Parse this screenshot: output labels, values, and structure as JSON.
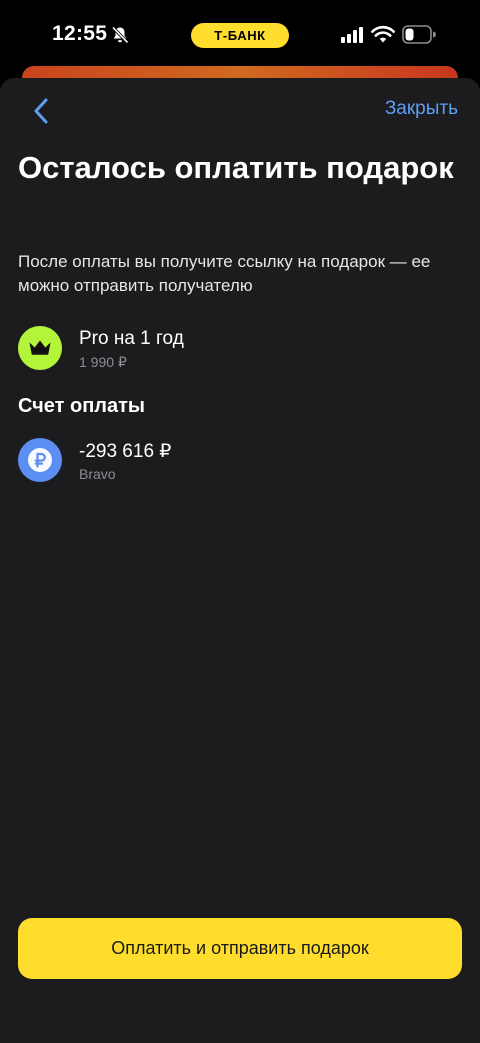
{
  "status_bar": {
    "time": "12:55",
    "carrier": "Т-БАНК",
    "icons": [
      "bell-slash-icon",
      "signal-icon",
      "wifi-icon",
      "battery-icon"
    ]
  },
  "colors": {
    "accent_yellow": "#ffdd2d",
    "link_blue": "#5e9ef5",
    "sheet_bg": "#1c1c1e",
    "pro_green": "#b3f53a",
    "bank_blue": "#5b8ef0"
  },
  "nav": {
    "back_icon": "chevron-left-icon",
    "close_label": "Закрыть"
  },
  "header": {
    "title": "Осталось оплатить подарок",
    "subtitle": "После оплаты вы получите ссылку на подарок — ее можно отправить получателю"
  },
  "product": {
    "icon": "crown-icon",
    "title": "Pro на 1 год",
    "price": "1 990 ₽"
  },
  "payment_account": {
    "section_title": "Счет оплаты",
    "icon": "ruble-icon",
    "balance": "-293 616 ₽",
    "name": "Bravo"
  },
  "actions": {
    "pay_label": "Оплатить и отправить подарок"
  }
}
